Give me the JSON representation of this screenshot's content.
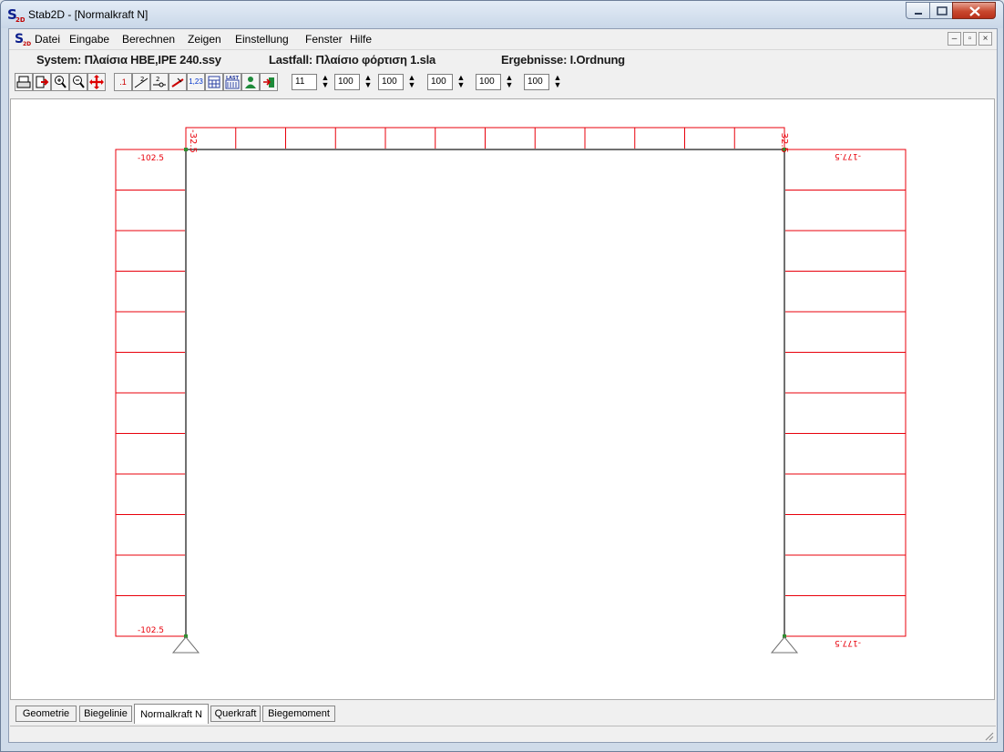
{
  "window": {
    "title": "Stab2D - [Normalkraft N]",
    "app_icon_text": "S",
    "app_icon_sub": "2D"
  },
  "menu": {
    "items": [
      "Datei",
      "Eingabe",
      "Berechnen",
      "Zeigen",
      "Einstellung",
      "Fenster",
      "Hilfe"
    ]
  },
  "info": {
    "system": "System: Πλαίσια HBE,IPE 240.ssy",
    "lastfall": "Lastfall: Πλαίσιο φόρτιση 1.sla",
    "ergebnisse": "Ergebnisse: I.Ordnung"
  },
  "toolbar": {
    "icons": [
      "print-icon",
      "export-icon",
      "zoom-in-icon",
      "zoom-out-icon",
      "move-icon",
      "node-numbers-icon",
      "member-numbers-icon",
      "support-numbers-icon",
      "load-icon",
      "values-icon",
      "table-icon",
      "load-case-icon",
      "person-icon",
      "exit-icon"
    ],
    "small_labels": [
      ".1",
      "2",
      "2",
      "",
      "1,23",
      "",
      "LAST",
      "",
      ""
    ],
    "spinners": [
      "11",
      "100",
      "100",
      "100",
      "100",
      "100"
    ]
  },
  "diagram": {
    "beam_label_left": "-32.5",
    "beam_label_right": "-32.5",
    "left_col_top": "-102.5",
    "left_col_bottom": "-102.5",
    "right_col_top": "-177.5",
    "right_col_bottom": "-177.5",
    "colors": {
      "force": "#e8000b",
      "member": "#707070",
      "node": "#2f8f2f"
    }
  },
  "tabs": {
    "items": [
      "Geometrie",
      "Biegelinie",
      "Normalkraft N",
      "Querkraft",
      "Biegemoment"
    ],
    "active": "Normalkraft N"
  }
}
